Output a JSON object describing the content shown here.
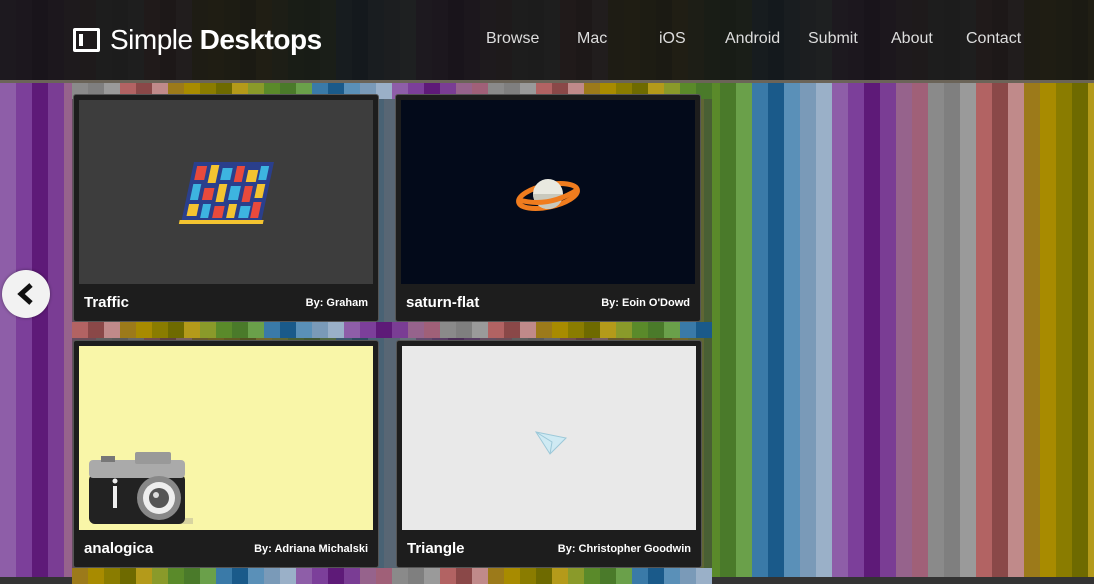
{
  "logo": {
    "light": "Simple",
    "bold": "Desktops"
  },
  "nav": {
    "items": [
      {
        "label": "Browse"
      },
      {
        "label": "Mac"
      },
      {
        "label": "iOS"
      },
      {
        "label": "Android"
      },
      {
        "label": "Submit"
      },
      {
        "label": "About"
      },
      {
        "label": "Contact"
      }
    ]
  },
  "cards": [
    {
      "title": "Traffic",
      "author": "By: Graham",
      "thumb_bg": "#3d3d3d"
    },
    {
      "title": "saturn-flat",
      "author": "By: Eoin O'Dowd",
      "thumb_bg": "#030a1a"
    },
    {
      "title": "analogica",
      "author": "By: Adriana Michalski",
      "thumb_bg": "#f9f6a8"
    },
    {
      "title": "Triangle",
      "author": "By: Christopher Goodwin",
      "thumb_bg": "#e9e9e9"
    }
  ],
  "colors": {
    "header_bg": "#141414",
    "card_bg": "#1d1d1d",
    "text": "#ffffff"
  },
  "icons": {
    "prev": "chevron-left-icon",
    "logo": "window-icon"
  }
}
